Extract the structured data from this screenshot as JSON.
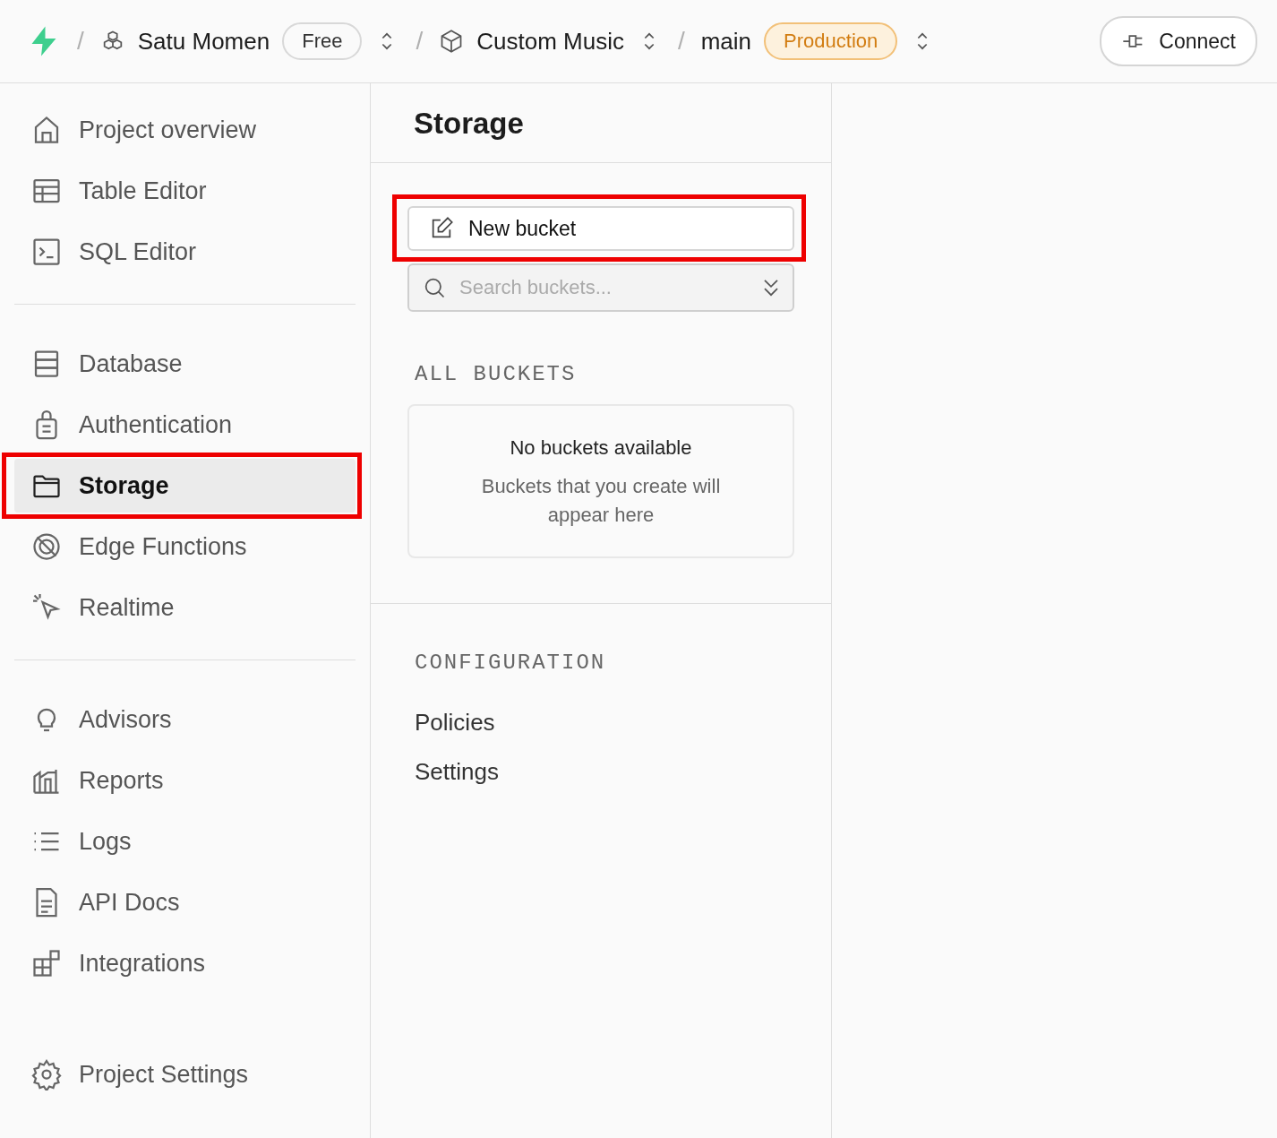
{
  "header": {
    "crumbs": [
      {
        "separator": "/",
        "kind": "org",
        "label": "Satu Momen",
        "badge": "Free"
      },
      {
        "separator": "/",
        "kind": "project",
        "label": "Custom Music"
      },
      {
        "separator": "/",
        "kind": "branch",
        "label": "main",
        "badge": "Production"
      }
    ],
    "connect": "Connect"
  },
  "sidebar": {
    "groups": [
      [
        {
          "label": "Project overview",
          "selected": false,
          "highlighted": false
        },
        {
          "label": "Table Editor",
          "selected": false,
          "highlighted": false
        },
        {
          "label": "SQL Editor",
          "selected": false,
          "highlighted": false
        }
      ],
      [
        {
          "label": "Database",
          "selected": false,
          "highlighted": false
        },
        {
          "label": "Authentication",
          "selected": false,
          "highlighted": false
        },
        {
          "label": "Storage",
          "selected": true,
          "highlighted": true
        },
        {
          "label": "Edge Functions",
          "selected": false,
          "highlighted": false
        },
        {
          "label": "Realtime",
          "selected": false,
          "highlighted": false
        }
      ],
      [
        {
          "label": "Advisors",
          "selected": false,
          "highlighted": false
        },
        {
          "label": "Reports",
          "selected": false,
          "highlighted": false
        },
        {
          "label": "Logs",
          "selected": false,
          "highlighted": false
        },
        {
          "label": "API Docs",
          "selected": false,
          "highlighted": false
        },
        {
          "label": "Integrations",
          "selected": false,
          "highlighted": false
        }
      ]
    ],
    "footer": {
      "label": "Project Settings",
      "selected": false,
      "highlighted": false
    }
  },
  "panel": {
    "title": "Storage",
    "new_bucket": {
      "label": "New bucket",
      "highlighted": true
    },
    "search": {
      "placeholder": "Search buckets..."
    },
    "section": "ALL BUCKETS",
    "empty": {
      "title": "No buckets available",
      "text": "Buckets that you create will appear here"
    },
    "configuration": {
      "heading": "CONFIGURATION",
      "links": [
        "Policies",
        "Settings"
      ]
    }
  }
}
